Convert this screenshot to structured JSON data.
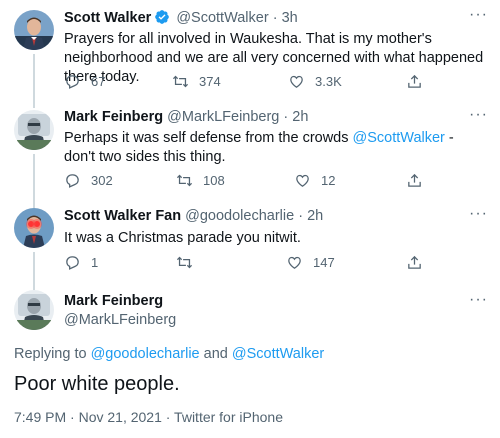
{
  "tweets": [
    {
      "name": "Scott Walker",
      "verified": true,
      "handle": "@ScottWalker",
      "time": "3h",
      "text": "Prayers for all involved in Waukesha. That is my mother's neighborhood and we are all very concerned with what happened there today.",
      "replies": "67",
      "retweets": "374",
      "likes": "3.3K"
    },
    {
      "name": "Mark Feinberg",
      "handle": "@MarkLFeinberg",
      "time": "2h",
      "text_before": "Perhaps it was self defense from the crowds ",
      "text_mention": "@ScottWalker",
      "text_after": " - don't two sides this thing.",
      "replies": "302",
      "retweets": "108",
      "likes": "12"
    },
    {
      "name": "Scott Walker Fan",
      "handle": "@goodolecharlie",
      "time": "2h",
      "text": "It was a Christmas parade you nitwit.",
      "replies": "1",
      "retweets": "",
      "likes": "147"
    }
  ],
  "separator": "·",
  "focus": {
    "name": "Mark Feinberg",
    "handle": "@MarkLFeinberg",
    "replying_prefix": "Replying to ",
    "replying_user1": "@goodolecharlie",
    "replying_and": " and ",
    "replying_user2": "@ScottWalker",
    "text": "Poor white people.",
    "timestamp": "7:49 PM · Nov 21, 2021 · Twitter for iPhone"
  },
  "icons": {
    "reply": "reply-icon",
    "retweet": "retweet-icon",
    "like": "heart-icon",
    "share": "share-icon",
    "more": "more-icon",
    "verified": "verified-badge-icon"
  },
  "colors": {
    "text": "#0f1419",
    "secondary": "#536471",
    "link": "#1d9bf0",
    "thread_line": "#cfd9de"
  }
}
